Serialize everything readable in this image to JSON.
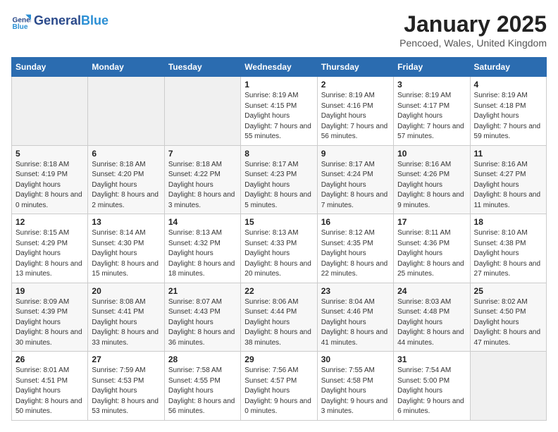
{
  "logo": {
    "line1": "General",
    "line2": "Blue"
  },
  "title": "January 2025",
  "subtitle": "Pencoed, Wales, United Kingdom",
  "weekdays": [
    "Sunday",
    "Monday",
    "Tuesday",
    "Wednesday",
    "Thursday",
    "Friday",
    "Saturday"
  ],
  "weeks": [
    [
      {
        "day": "",
        "info": ""
      },
      {
        "day": "",
        "info": ""
      },
      {
        "day": "",
        "info": ""
      },
      {
        "day": "1",
        "sunrise": "Sunrise: 8:19 AM",
        "sunset": "Sunset: 4:15 PM",
        "daylight": "Daylight: 7 hours and 55 minutes."
      },
      {
        "day": "2",
        "sunrise": "Sunrise: 8:19 AM",
        "sunset": "Sunset: 4:16 PM",
        "daylight": "Daylight: 7 hours and 56 minutes."
      },
      {
        "day": "3",
        "sunrise": "Sunrise: 8:19 AM",
        "sunset": "Sunset: 4:17 PM",
        "daylight": "Daylight: 7 hours and 57 minutes."
      },
      {
        "day": "4",
        "sunrise": "Sunrise: 8:19 AM",
        "sunset": "Sunset: 4:18 PM",
        "daylight": "Daylight: 7 hours and 59 minutes."
      }
    ],
    [
      {
        "day": "5",
        "sunrise": "Sunrise: 8:18 AM",
        "sunset": "Sunset: 4:19 PM",
        "daylight": "Daylight: 8 hours and 0 minutes."
      },
      {
        "day": "6",
        "sunrise": "Sunrise: 8:18 AM",
        "sunset": "Sunset: 4:20 PM",
        "daylight": "Daylight: 8 hours and 2 minutes."
      },
      {
        "day": "7",
        "sunrise": "Sunrise: 8:18 AM",
        "sunset": "Sunset: 4:22 PM",
        "daylight": "Daylight: 8 hours and 3 minutes."
      },
      {
        "day": "8",
        "sunrise": "Sunrise: 8:17 AM",
        "sunset": "Sunset: 4:23 PM",
        "daylight": "Daylight: 8 hours and 5 minutes."
      },
      {
        "day": "9",
        "sunrise": "Sunrise: 8:17 AM",
        "sunset": "Sunset: 4:24 PM",
        "daylight": "Daylight: 8 hours and 7 minutes."
      },
      {
        "day": "10",
        "sunrise": "Sunrise: 8:16 AM",
        "sunset": "Sunset: 4:26 PM",
        "daylight": "Daylight: 8 hours and 9 minutes."
      },
      {
        "day": "11",
        "sunrise": "Sunrise: 8:16 AM",
        "sunset": "Sunset: 4:27 PM",
        "daylight": "Daylight: 8 hours and 11 minutes."
      }
    ],
    [
      {
        "day": "12",
        "sunrise": "Sunrise: 8:15 AM",
        "sunset": "Sunset: 4:29 PM",
        "daylight": "Daylight: 8 hours and 13 minutes."
      },
      {
        "day": "13",
        "sunrise": "Sunrise: 8:14 AM",
        "sunset": "Sunset: 4:30 PM",
        "daylight": "Daylight: 8 hours and 15 minutes."
      },
      {
        "day": "14",
        "sunrise": "Sunrise: 8:13 AM",
        "sunset": "Sunset: 4:32 PM",
        "daylight": "Daylight: 8 hours and 18 minutes."
      },
      {
        "day": "15",
        "sunrise": "Sunrise: 8:13 AM",
        "sunset": "Sunset: 4:33 PM",
        "daylight": "Daylight: 8 hours and 20 minutes."
      },
      {
        "day": "16",
        "sunrise": "Sunrise: 8:12 AM",
        "sunset": "Sunset: 4:35 PM",
        "daylight": "Daylight: 8 hours and 22 minutes."
      },
      {
        "day": "17",
        "sunrise": "Sunrise: 8:11 AM",
        "sunset": "Sunset: 4:36 PM",
        "daylight": "Daylight: 8 hours and 25 minutes."
      },
      {
        "day": "18",
        "sunrise": "Sunrise: 8:10 AM",
        "sunset": "Sunset: 4:38 PM",
        "daylight": "Daylight: 8 hours and 27 minutes."
      }
    ],
    [
      {
        "day": "19",
        "sunrise": "Sunrise: 8:09 AM",
        "sunset": "Sunset: 4:39 PM",
        "daylight": "Daylight: 8 hours and 30 minutes."
      },
      {
        "day": "20",
        "sunrise": "Sunrise: 8:08 AM",
        "sunset": "Sunset: 4:41 PM",
        "daylight": "Daylight: 8 hours and 33 minutes."
      },
      {
        "day": "21",
        "sunrise": "Sunrise: 8:07 AM",
        "sunset": "Sunset: 4:43 PM",
        "daylight": "Daylight: 8 hours and 36 minutes."
      },
      {
        "day": "22",
        "sunrise": "Sunrise: 8:06 AM",
        "sunset": "Sunset: 4:44 PM",
        "daylight": "Daylight: 8 hours and 38 minutes."
      },
      {
        "day": "23",
        "sunrise": "Sunrise: 8:04 AM",
        "sunset": "Sunset: 4:46 PM",
        "daylight": "Daylight: 8 hours and 41 minutes."
      },
      {
        "day": "24",
        "sunrise": "Sunrise: 8:03 AM",
        "sunset": "Sunset: 4:48 PM",
        "daylight": "Daylight: 8 hours and 44 minutes."
      },
      {
        "day": "25",
        "sunrise": "Sunrise: 8:02 AM",
        "sunset": "Sunset: 4:50 PM",
        "daylight": "Daylight: 8 hours and 47 minutes."
      }
    ],
    [
      {
        "day": "26",
        "sunrise": "Sunrise: 8:01 AM",
        "sunset": "Sunset: 4:51 PM",
        "daylight": "Daylight: 8 hours and 50 minutes."
      },
      {
        "day": "27",
        "sunrise": "Sunrise: 7:59 AM",
        "sunset": "Sunset: 4:53 PM",
        "daylight": "Daylight: 8 hours and 53 minutes."
      },
      {
        "day": "28",
        "sunrise": "Sunrise: 7:58 AM",
        "sunset": "Sunset: 4:55 PM",
        "daylight": "Daylight: 8 hours and 56 minutes."
      },
      {
        "day": "29",
        "sunrise": "Sunrise: 7:56 AM",
        "sunset": "Sunset: 4:57 PM",
        "daylight": "Daylight: 9 hours and 0 minutes."
      },
      {
        "day": "30",
        "sunrise": "Sunrise: 7:55 AM",
        "sunset": "Sunset: 4:58 PM",
        "daylight": "Daylight: 9 hours and 3 minutes."
      },
      {
        "day": "31",
        "sunrise": "Sunrise: 7:54 AM",
        "sunset": "Sunset: 5:00 PM",
        "daylight": "Daylight: 9 hours and 6 minutes."
      },
      {
        "day": "",
        "info": ""
      }
    ]
  ]
}
